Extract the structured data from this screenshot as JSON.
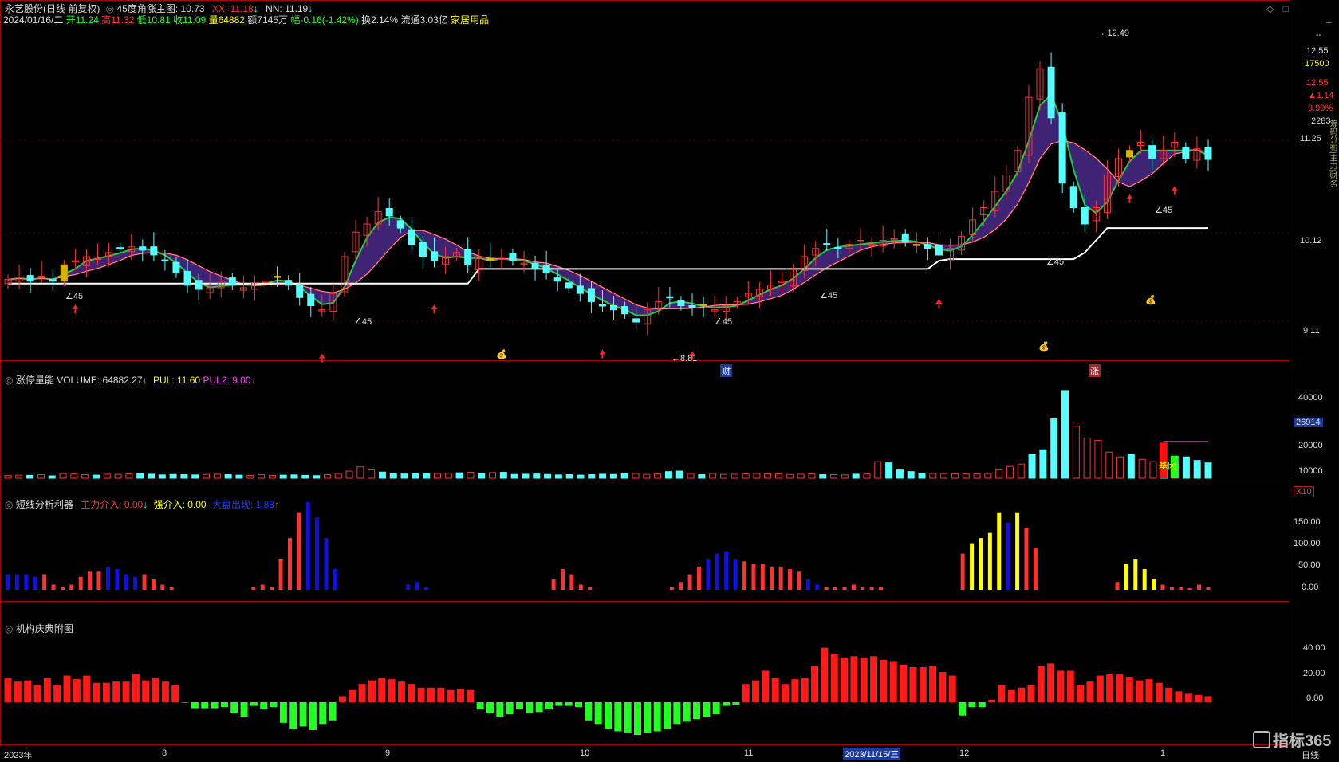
{
  "header": {
    "stock_name": "永艺股份(日线 前复权)",
    "indicator_name": "45度角涨主图",
    "indicator_value": ": 10.73",
    "xx_label": "XX: 11.18",
    "nn_label": "NN: 11.19",
    "date": "2024/01/16/二",
    "open": "开11.24",
    "high": "高11.32",
    "low": "低10.81",
    "close": "收11.09",
    "volume": "量64882",
    "amount": "额7145万",
    "change": "幅-0.16(-1.42%)",
    "turnover": "换2.14%",
    "float": "流通3.03亿",
    "sector": "家居用品"
  },
  "price_axis": {
    "labels": [
      "12.55",
      "11.25",
      "10.12",
      "9.11"
    ],
    "side_info": [
      "--",
      "--",
      "12.55",
      "17500",
      "12.55",
      "▲1.14",
      "9.99%",
      "2283"
    ],
    "high_marker": "12.49",
    "low_marker": "8.81",
    "angle_label": "∠45",
    "side_strip": "筹码分布|主力|财务"
  },
  "panels": {
    "volume": {
      "title": "涨停量能",
      "volume": "VOLUME: 64882.27",
      "pul": "PUL: 11.60",
      "pul2": "PUL2: 9.00",
      "axis": [
        "40000",
        "20000",
        "10000"
      ],
      "highlight": "26914",
      "unit": "X10",
      "tag": "基因"
    },
    "short": {
      "title": "短线分析利器",
      "main_in": "主力介入: 0.00",
      "strong_in": "强介入: 0.00",
      "exit": "大盘出现: 1.88",
      "axis": [
        "150.00",
        "100.00",
        "50.00",
        "0.00"
      ]
    },
    "inst": {
      "title": "机构庆典附图",
      "axis": [
        "40.00",
        "20.00",
        "0.00"
      ]
    }
  },
  "time_axis": {
    "labels": [
      "2023年",
      "8",
      "9",
      "10",
      "11",
      "2023/11/15/三",
      "12",
      "1"
    ],
    "period": "日线",
    "brand": "指标365"
  },
  "markers": {
    "cai": "财",
    "zhang": "涨"
  },
  "colors": {
    "up": "#ff3232",
    "down": "#54ffff",
    "yellow": "#ffff00",
    "blue": "#1010e0",
    "green": "#22ff22"
  },
  "chart_data": {
    "type": "bar",
    "title": "",
    "price_candles_close": [
      9.62,
      9.65,
      9.6,
      9.66,
      9.6,
      9.8,
      9.85,
      9.9,
      9.88,
      9.95,
      10.0,
      10.02,
      9.98,
      9.92,
      9.85,
      9.7,
      9.55,
      9.5,
      9.52,
      9.6,
      9.55,
      9.52,
      9.58,
      9.6,
      9.65,
      9.55,
      9.4,
      9.3,
      9.25,
      9.45,
      9.9,
      10.2,
      10.3,
      10.45,
      10.4,
      10.25,
      10.05,
      9.9,
      9.85,
      9.9,
      9.95,
      9.8,
      9.9,
      9.85,
      9.88,
      9.85,
      9.82,
      9.75,
      9.7,
      9.6,
      9.52,
      9.45,
      9.35,
      9.3,
      9.25,
      9.2,
      9.1,
      9.25,
      9.35,
      9.4,
      9.3,
      9.28,
      9.3,
      9.25,
      9.3,
      9.35,
      9.45,
      9.5,
      9.55,
      9.6,
      9.75,
      9.9,
      10.0,
      10.05,
      10.0,
      10.05,
      10.1,
      10.05,
      10.1,
      10.12,
      10.08,
      10.05,
      10.0,
      9.92,
      10.0,
      10.15,
      10.35,
      10.5,
      10.7,
      10.9,
      11.2,
      11.85,
      12.2,
      11.6,
      10.8,
      10.5,
      10.3,
      10.5,
      10.9,
      11.1,
      11.2,
      11.3,
      11.1,
      11.2,
      11.3,
      11.1,
      11.22,
      11.09
    ],
    "volume_x10": [
      1100,
      1300,
      1200,
      1500,
      1000,
      2000,
      1800,
      1500,
      1300,
      1700,
      1600,
      1900,
      2200,
      1700,
      1400,
      1600,
      1500,
      1400,
      1600,
      1700,
      1500,
      1300,
      1200,
      1500,
      1200,
      1300,
      1400,
      1200,
      1100,
      1500,
      2000,
      3000,
      4800,
      3500,
      2600,
      2000,
      1800,
      1900,
      2100,
      2000,
      2100,
      2300,
      2500,
      2000,
      2400,
      2500,
      1600,
      1700,
      1800,
      1600,
      1400,
      1500,
      1300,
      1500,
      1700,
      1600,
      1900,
      2000,
      1600,
      1800,
      2800,
      3000,
      2000,
      1500,
      2000,
      1600,
      1700,
      1800,
      2000,
      1900,
      1800,
      1600,
      1700,
      1800,
      1500,
      1500,
      1400,
      1700,
      1900,
      7000,
      6500,
      3500,
      2800,
      2200,
      2000,
      2000,
      1900,
      1900,
      1800,
      2000,
      3500,
      5000,
      6000,
      10000,
      12000,
      25000,
      37000,
      22000,
      17000,
      16000,
      11000,
      9000,
      10000,
      8000,
      7000,
      6000,
      7000,
      9000,
      7500,
      6488
    ],
    "short_signal": [
      30,
      30,
      30,
      25,
      30,
      10,
      5,
      10,
      25,
      35,
      35,
      45,
      40,
      30,
      25,
      30,
      20,
      10,
      5,
      0,
      0,
      0,
      0,
      0,
      0,
      0,
      0,
      5,
      10,
      5,
      60,
      100,
      150,
      170,
      140,
      100,
      40,
      0,
      0,
      0,
      0,
      0,
      0,
      0,
      10,
      15,
      5,
      0,
      0,
      0,
      0,
      0,
      0,
      0,
      0,
      0,
      0,
      0,
      0,
      0,
      20,
      40,
      30,
      10,
      5,
      0,
      0,
      0,
      0,
      0,
      0,
      0,
      0,
      5,
      15,
      30,
      45,
      60,
      70,
      75,
      60,
      55,
      50,
      50,
      45,
      45,
      40,
      35,
      20,
      10,
      5,
      5,
      5,
      10,
      5,
      5,
      5,
      0,
      0,
      0,
      0,
      0,
      0,
      0,
      0,
      70,
      90,
      100,
      110,
      150,
      130,
      150,
      120,
      80,
      0,
      0,
      0,
      0,
      0,
      0,
      0,
      0,
      15,
      50,
      60,
      40,
      20,
      10,
      5,
      5,
      3,
      10,
      5
    ],
    "inst_signal": [
      20,
      17,
      18,
      14,
      20,
      14,
      22,
      19,
      22,
      16,
      16,
      17,
      17,
      23,
      18,
      20,
      17,
      14,
      0,
      -5,
      -5,
      -5,
      -4,
      -9,
      -12,
      -3,
      -6,
      -4,
      -17,
      -22,
      -20,
      -23,
      -18,
      -15,
      5,
      10,
      15,
      18,
      20,
      19,
      17,
      15,
      12,
      12,
      12,
      10,
      11,
      10,
      -6,
      -9,
      -12,
      -10,
      -6,
      -9,
      -8,
      -6,
      -3,
      -3,
      -4,
      -15,
      -18,
      -22,
      -24,
      -25,
      -27,
      -25,
      -24,
      -22,
      -18,
      -16,
      -14,
      -12,
      -10,
      -3,
      -2,
      15,
      18,
      26,
      20,
      15,
      19,
      20,
      30,
      45,
      40,
      37,
      38,
      37,
      38,
      35,
      34,
      31,
      29,
      29,
      30,
      25,
      22,
      -11,
      -4,
      -4,
      2,
      14,
      10,
      12,
      14,
      30,
      32,
      26,
      26,
      14,
      17,
      22,
      23,
      23,
      21,
      18,
      19,
      16,
      12,
      9,
      7,
      6,
      5
    ]
  }
}
